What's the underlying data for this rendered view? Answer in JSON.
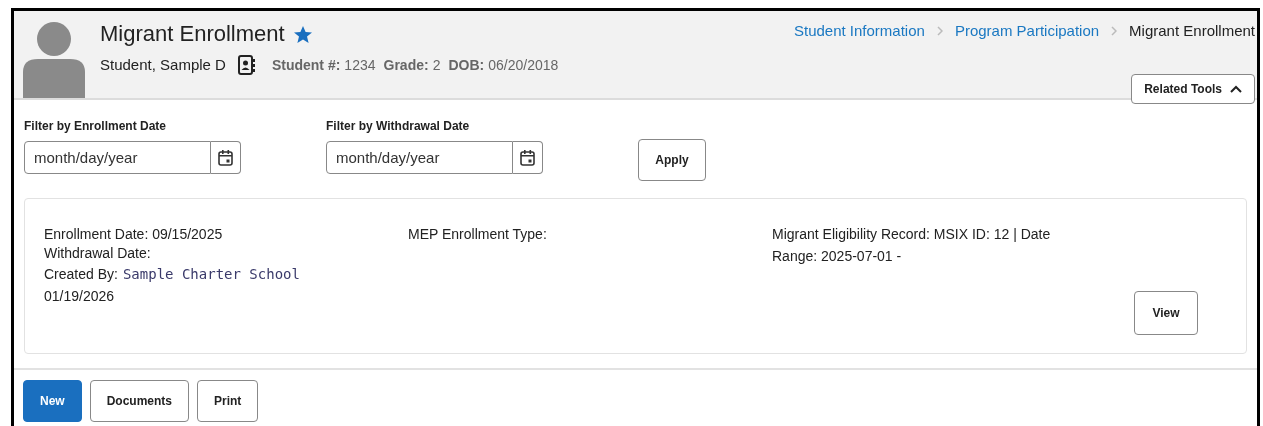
{
  "header": {
    "title": "Migrant Enrollment",
    "favorite": true,
    "student_name": "Student, Sample D",
    "details": [
      {
        "label": "Student #:",
        "value": "1234"
      },
      {
        "label": "Grade:",
        "value": "2"
      },
      {
        "label": "DOB:",
        "value": "06/20/2018"
      }
    ],
    "breadcrumbs": [
      {
        "label": "Student Information",
        "link": true
      },
      {
        "label": "Program Participation",
        "link": true
      },
      {
        "label": "Migrant Enrollment",
        "link": false
      }
    ],
    "related_tools": {
      "label": "Related Tools",
      "expanded": true
    }
  },
  "filters": [
    {
      "label": "Filter by Enrollment Date",
      "placeholder": "month/day/year"
    },
    {
      "label": "Filter by Withdrawal Date",
      "placeholder": "month/day/year"
    }
  ],
  "apply_button": "Apply",
  "record": {
    "enrollment_date": "Enrollment Date: 09/15/2025",
    "withdrawal_date": "Withdrawal Date:",
    "created_by_label": "Created By:",
    "created_by_value": "Sample Charter School",
    "created_date": "01/19/2026",
    "mep_type": "MEP Enrollment Type:",
    "eligibility": "Migrant Eligibility Record: MSIX ID: 12 | Date Range: 2025-07-01 -",
    "view_button": "View"
  },
  "buttons": [
    {
      "label": "New",
      "primary": true
    },
    {
      "label": "Documents",
      "primary": false
    },
    {
      "label": "Print",
      "primary": false
    }
  ]
}
